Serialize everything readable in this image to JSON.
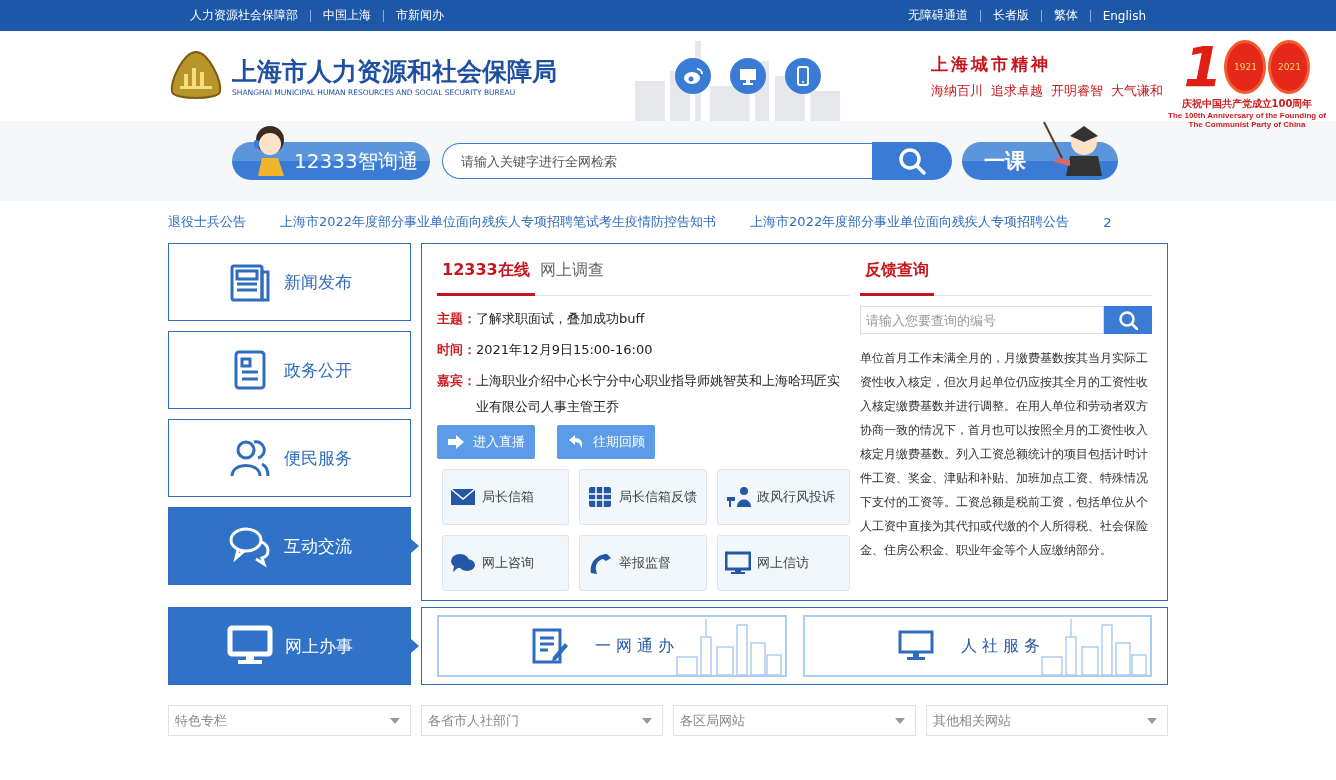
{
  "top_links_left": [
    "人力资源社会保障部",
    "中国上海",
    "市新闻办"
  ],
  "top_links_right": [
    "无障碍通道",
    "长者版",
    "繁体",
    "English"
  ],
  "header": {
    "title": "上海市人力资源和社会保障局",
    "subtitle": "SHANGHAI MUNICIPAL HUMAN RESOURCES AND SOCIAL SECURITY BUREAU",
    "slogan_title": "上海城市精神",
    "slogan_words": [
      "海纳百川",
      "追求卓越",
      "开明睿智",
      "大气谦和"
    ],
    "emblem": {
      "digit": "1",
      "years": [
        "1921",
        "2021"
      ],
      "caption": "庆祝中国共产党成立100周年",
      "caption_en": [
        "The 100th Anniversary of the Founding of",
        "The Communist Party of China"
      ]
    }
  },
  "search": {
    "assistant_label": "12333智询通",
    "placeholder": "请输入关键字进行全网检索",
    "course_label": "一课"
  },
  "ticker": [
    "退役士兵公告",
    "上海市2022年度部分事业单位面向残疾人专项招聘笔试考生疫情防控告知书",
    "上海市2022年度部分事业单位面向残疾人专项招聘公告",
    "2"
  ],
  "nav": [
    {
      "label": "新闻发布",
      "kind": "news",
      "selected": false
    },
    {
      "label": "政务公开",
      "kind": "doc",
      "selected": false
    },
    {
      "label": "便民服务",
      "kind": "people",
      "selected": false
    },
    {
      "label": "互动交流",
      "kind": "chat",
      "selected": true
    }
  ],
  "online": {
    "tabs": [
      {
        "label": "12333在线",
        "selected": true
      },
      {
        "label": "网上调查",
        "selected": false
      }
    ],
    "fields": [
      {
        "label": "主题：",
        "value": "了解求职面试，叠加成功buff"
      },
      {
        "label": "时间：",
        "value": "2021年12月9日15:00-16:00"
      },
      {
        "label": "嘉宾：",
        "value": "上海职业介绍中心长宁分中心职业指导师姚智英和上海哈玛匠实业有限公司人事主管王乔"
      }
    ],
    "buttons": [
      {
        "label": "进入直播",
        "kind": "arrow"
      },
      {
        "label": "往期回顾",
        "kind": "back"
      }
    ],
    "tiles": [
      {
        "label": "局长信箱",
        "kind": "mail"
      },
      {
        "label": "局长信箱反馈",
        "kind": "grid"
      },
      {
        "label": "政风行风投诉",
        "kind": "speaker"
      },
      {
        "label": "网上咨询",
        "kind": "chat"
      },
      {
        "label": "举报监督",
        "kind": "phone"
      },
      {
        "label": "网上信访",
        "kind": "monitor"
      }
    ]
  },
  "feedback": {
    "title": "反馈查询",
    "placeholder": "请输入您要查询的编号",
    "text": "单位首月工作未满全月的，月缴费基数按其当月实际工资性收入核定，但次月起单位仍应按其全月的工资性收入核定缴费基数并进行调整。在用人单位和劳动者双方协商一致的情况下，首月也可以按照全月的工资性收入核定月缴费基数。列入工资总额统计的项目包括计时计件工资、奖金、津贴和补贴、加班加点工资、特殊情况下支付的工资等。工资总额是税前工资，包括单位从个人工资中直接为其代扣或代缴的个人所得税、社会保险金、住房公积金、职业年金等个人应缴纳部分。"
  },
  "services": {
    "label": "网上办事",
    "selected": true,
    "tiles": [
      {
        "label": "一 网 通 办",
        "kind": "form"
      },
      {
        "label": "人 社 服 务",
        "kind": "monitor"
      }
    ]
  },
  "dropdowns": [
    "特色专栏",
    "各省市人社部门",
    "各区局网站",
    "其他相关网站"
  ]
}
